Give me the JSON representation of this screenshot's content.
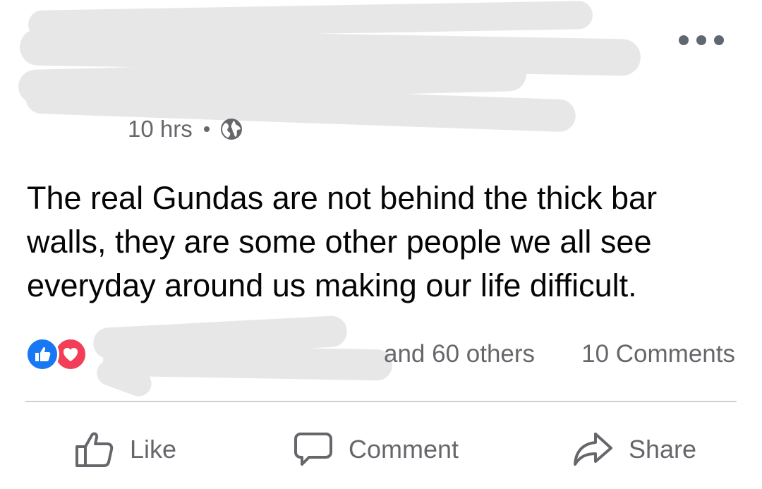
{
  "post": {
    "timestamp": "10 hrs",
    "privacy_icon": "globe-icon",
    "more_icon": "more-options-icon",
    "text": "The real Gundas are not behind the thick bar walls, they are some other people we all see everyday around us making our life difficult."
  },
  "reactions": {
    "icons": [
      "like-reaction-icon",
      "love-reaction-icon"
    ],
    "summary": "and 60 others",
    "comments": "10 Comments"
  },
  "actions": {
    "like": "Like",
    "comment": "Comment",
    "share": "Share"
  },
  "colors": {
    "meta_text": "#65676b",
    "like_blue": "#1877f2",
    "love_red": "#f33e58",
    "redaction": "#e7e7e7"
  }
}
